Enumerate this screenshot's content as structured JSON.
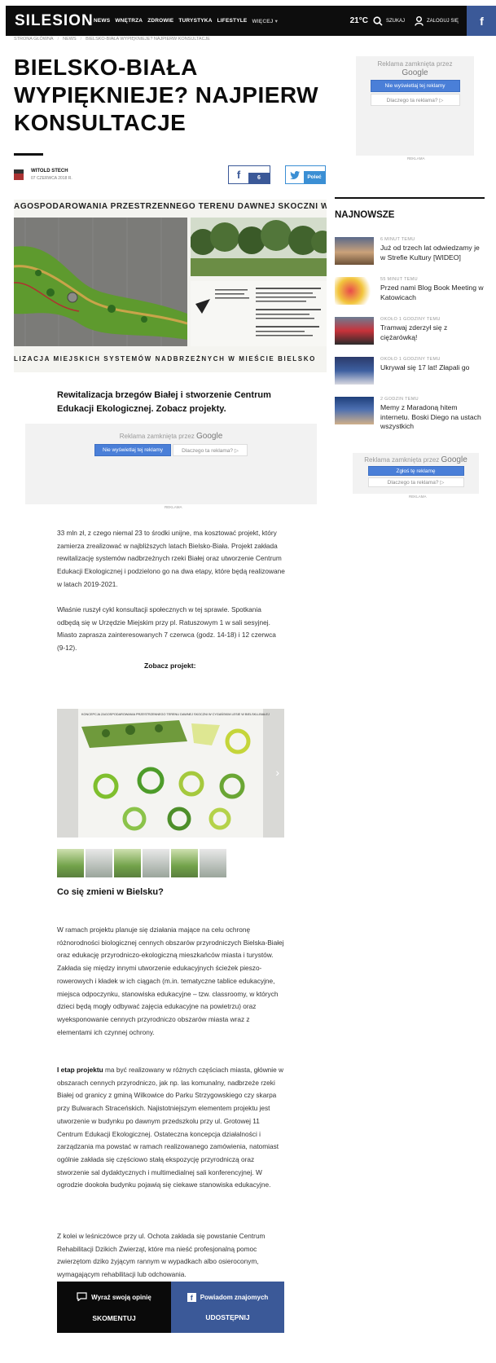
{
  "nav": {
    "logo": "SILESION",
    "items": [
      "NEWS",
      "WNĘTRZA",
      "ZDROWIE",
      "TURYSTYKA",
      "LIFESTYLE",
      "WIĘCEJ ▾"
    ],
    "weather": "21°C",
    "search_label": "SZUKAJ",
    "login_label": "ZALOGUJ SIĘ",
    "fb": "f"
  },
  "breadcrumb": [
    "STRONA GŁÓWNA",
    "NEWS",
    "BIELSKO-BIAŁA WYPIĘKNIEJE? NAJPIERW KONSULTACJE"
  ],
  "article": {
    "title": "BIELSKO-BIAŁA WYPIĘKNIEJE? NAJPIERW KONSULTACJE",
    "author": "WITOLD STECH",
    "date": "07 CZERWCA 2018 R.",
    "share_fb_count": "6",
    "share_tw_label": "Poleć",
    "hero_heading": "AGOSPODAROWANIA PRZESTRZENNEGO TERENU DAWNEJ SKOCZNI W CYGAŃSKIM LESIE W B",
    "hero_strip": "LIZACJA  MIEJSKICH  SYSTEMÓW  NADBRZEŻNYCH  W  MIEŚCIE  BIELSKO",
    "lead": "Rewitalizacja brzegów Białej i stworzenie Centrum Edukacji Ekologicznej. Zobacz projekty.",
    "p1": "33 mln zł, z czego niemal 23 to środki unijne, ma kosztować projekt, który zamierza zrealizować w najbliższych latach Bielsko-Biała. Projekt zakłada rewitalizację systemów nadbrzeżnych rzeki Białej oraz utworzenie Centrum Edukacji Ekologicznej i podzielono go na dwa etapy, które będą realizowane w latach 2019-2021.",
    "p2": "Właśnie ruszył cykl konsultacji społecznych w tej sprawie. Spotkania odbędą się w Urzędzie Miejskim przy pl. Ratuszowym 1 w sali sesyjnej. Miasto zaprasza zainteresowanych 7 czerwca (godz. 14-18) i 12 czerwca (9-12).",
    "see_project": "Zobacz projekt:",
    "gallery_head": "KONCEPCJA ZAGOSPODAROWANIA PRZESTRZENNEGO TERENU DAWNEJ SKOCZNI W CYGAŃSKIM LESIE W BIELSKU-BIAŁEJ",
    "h2": "Co się zmieni w Bielsku?",
    "p3": "W ramach projektu planuje się działania mające na celu ochronę różnorodności biologicznej cennych obszarów przyrodniczych Bielska-Białej oraz edukację przyrodniczo-ekologiczną mieszkańców miasta i turystów. Zakłada się między innymi utworzenie edukacyjnych ścieżek pieszo-rowerowych i kładek w ich ciągach (m.in. tematyczne tablice edukacyjne, miejsca odpoczynku, stanowiska edukacyjne – tzw. classroomy, w których dzieci będą mogły odbywać zajęcia edukacyjne na powietrzu) oraz wyeksponowanie cennych przyrodniczo obszarów miasta wraz z elementami ich czynnej ochrony.",
    "p4_bold": "I etap projektu",
    "p4": " ma być realizowany w różnych częściach miasta, głównie w obszarach cennych przyrodniczo, jak np. las komunalny, nadbrzeże rzeki Białej od granicy z gminą Wilkowice do Parku Strzygowskiego czy skarpa przy Bulwarach Straceńskich. Najistotniejszym elementem projektu jest utworzenie w budynku po dawnym przedszkolu przy ul. Grotowej 11 Centrum Edukacji Ekologicznej. Ostateczna koncepcja działalności i zarządzania ma powstać w ramach realizowanego zamówienia, natomiast ogólnie zakłada się częściowo stałą ekspozycję przyrodniczą oraz stworzenie sal dydaktycznych i multimedialnej sali konferencyjnej. W ogrodzie dookoła budynku pojawią się ciekawe stanowiska edukacyjne.",
    "p5": "Z kolei w leśniczówce przy ul. Ochota zakłada się powstanie Centrum Rehabilitacji Dzikich Zwierząt, które ma nieść profesjonalną pomoc zwierzętom dziko żyjącym rannym w wypadkach albo osieroconym, wymagającym rehabilitacji lub odchowania."
  },
  "comment_bar": {
    "left_top": "Wyraź swoją opinię",
    "left_bottom": "SKOMENTUJ",
    "right_top": "Powiadom znajomych",
    "right_bottom": "UDOSTĘPNIJ"
  },
  "ads": {
    "closed_by": "Reklama zamknięta przez",
    "google": "Google",
    "dont_show": "Nie wyświetlaj tej reklamy",
    "why": "Dlaczego ta reklama? ▷",
    "report": "Zgłoś tę reklamę",
    "tag": "REKLAMA"
  },
  "sidebar": {
    "heading": "NAJNOWSZE",
    "items": [
      {
        "time": "6 MINUT TEMU",
        "title": "Już od trzech lat odwiedzamy je w Strefie Kultury [WIDEO]"
      },
      {
        "time": "55 MINUT TEMU",
        "title": "Przed nami Blog Book Meeting w Katowicach"
      },
      {
        "time": "OKOŁO 1 GODZINY TEMU",
        "title": "Tramwaj zderzył się z ciężarówką!"
      },
      {
        "time": "OKOŁO 1 GODZINY TEMU",
        "title": "Ukrywał się 17 lat! Złapali go"
      },
      {
        "time": "2 GODZIN TEMU",
        "title": "Memy z Maradoną hitem internetu. Boski Diego na ustach wszystkich"
      }
    ]
  },
  "colors": {
    "facebook": "#3b5998",
    "twitter": "#3b8fd4",
    "accent_black": "#0d0d0d"
  }
}
